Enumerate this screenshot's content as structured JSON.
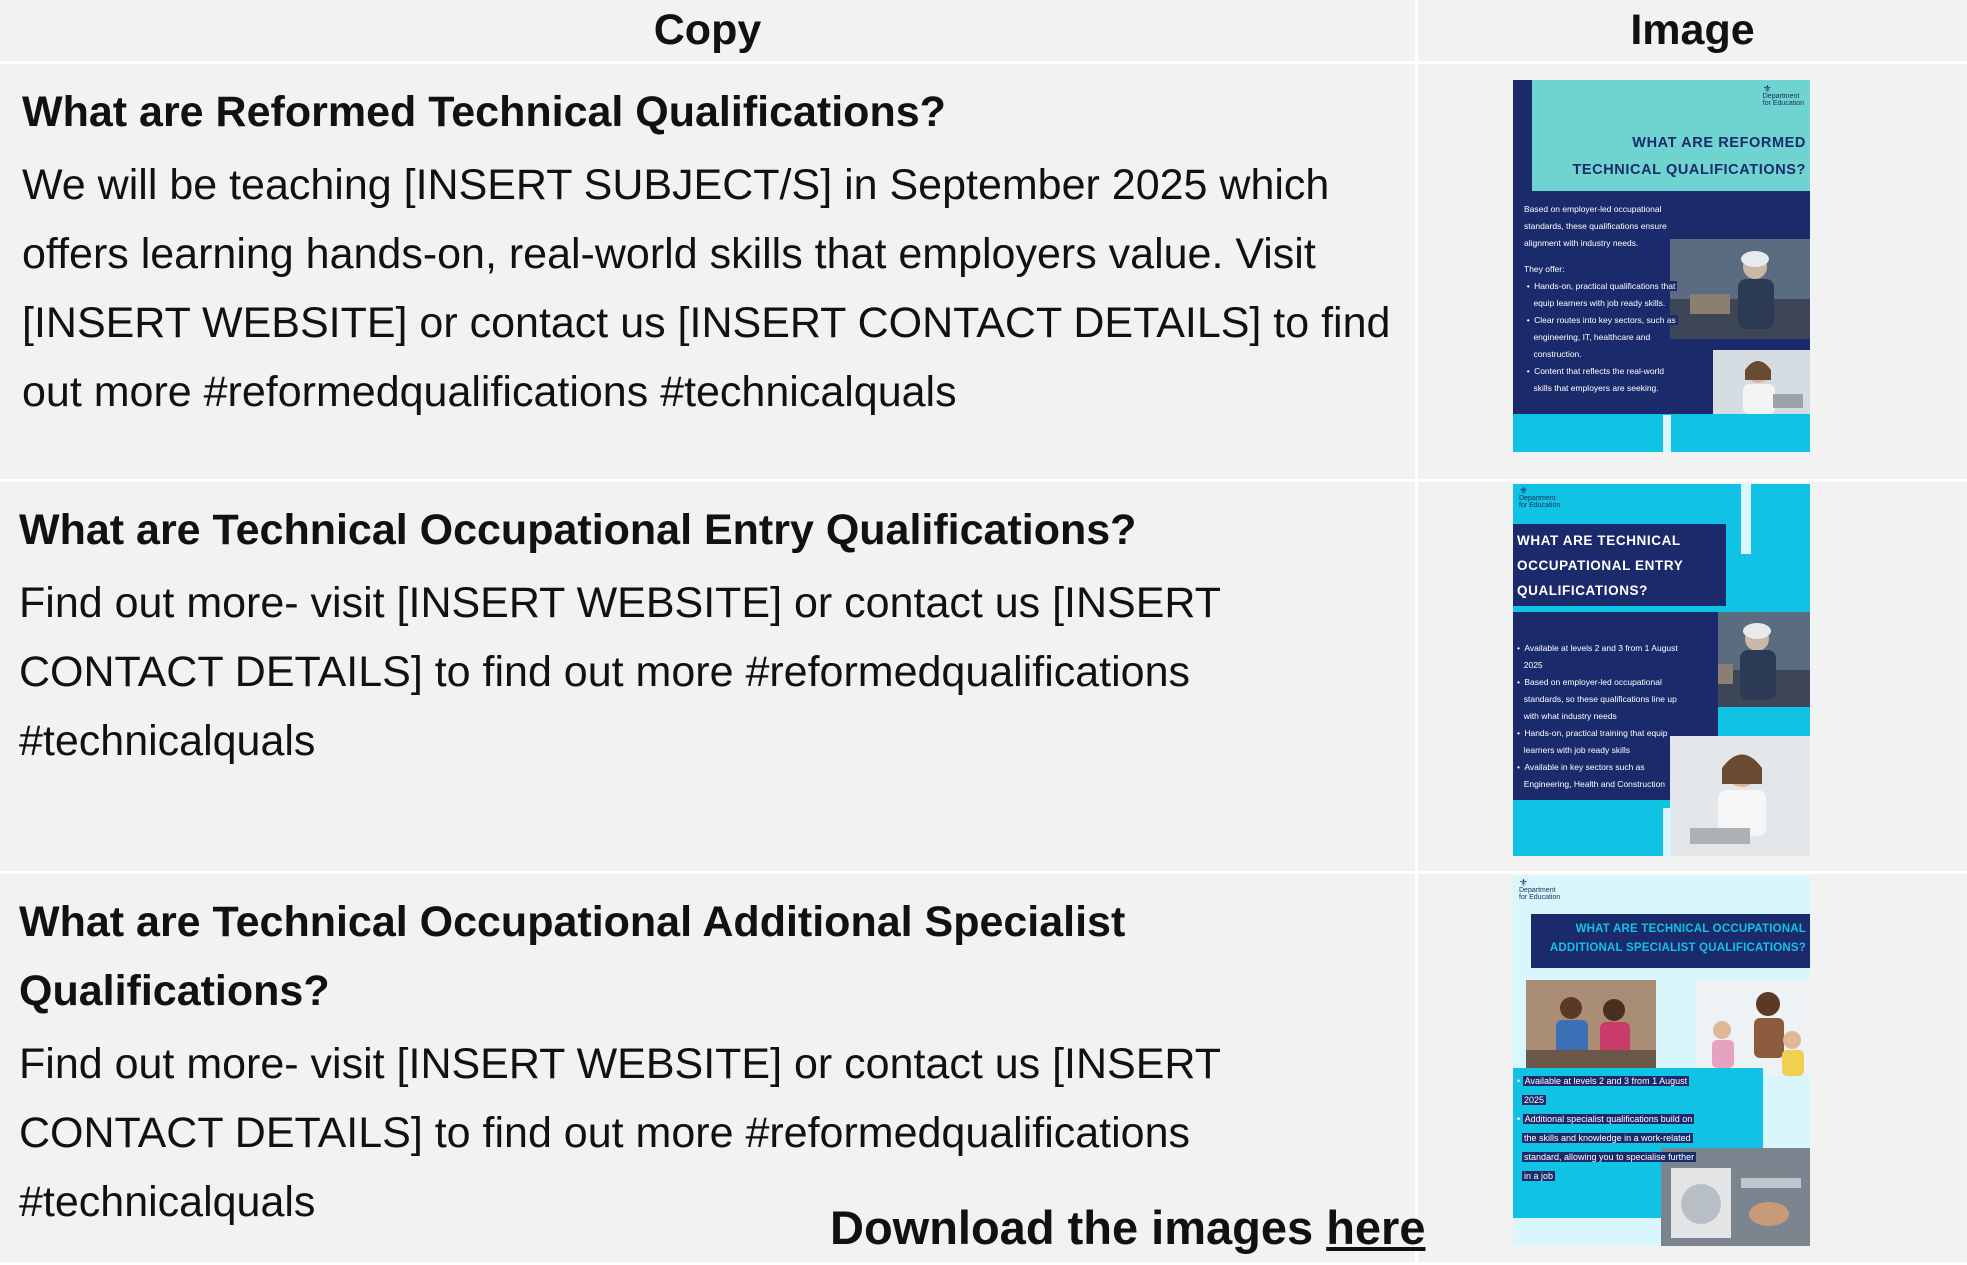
{
  "table": {
    "header": {
      "copy": "Copy",
      "image": "Image"
    },
    "rows": [
      {
        "title": "What are Reformed Technical Qualifications?",
        "body": "We will be teaching [INSERT SUBJECT/S] in September 2025 which offers learning hands-on, real-world skills that employers value. Visit [INSERT WEBSITE] or contact us [INSERT CONTACT DETAILS] to find out more #reformedqualifications #technicalquals",
        "poster": {
          "org_line1": "Department",
          "org_line2": "for Education",
          "title_line1": "WHAT ARE REFORMED",
          "title_line2": "TECHNICAL QUALIFICATIONS?",
          "intro": [
            "Based on employer-led occupational",
            "standards, these qualifications ensure",
            "alignment with industry needs."
          ],
          "offer_label": "They offer:",
          "bullets": [
            [
              "Hands-on, practical qualifications that",
              "equip learners with job ready skills."
            ],
            [
              "Clear routes into key sectors, such as",
              "engineering, IT, healthcare and",
              "construction."
            ],
            [
              "Content that reflects the real-world",
              "skills that employers are seeking."
            ]
          ]
        }
      },
      {
        "title": "What are Technical Occupational Entry Qualifications?",
        "body": "Find out more- visit [INSERT WEBSITE] or contact us [INSERT CONTACT DETAILS] to find out more #reformedqualifications #technicalquals",
        "poster": {
          "org_line1": "Department",
          "org_line2": "for Education",
          "title_lines": [
            "WHAT ARE TECHNICAL",
            "OCCUPATIONAL ENTRY",
            "QUALIFICATIONS?"
          ],
          "bullets": [
            [
              "Available at levels 2 and 3 from 1 August",
              "2025"
            ],
            [
              "Based on employer-led occupational",
              "standards, so these qualifications line up",
              "with what industry needs"
            ],
            [
              "Hands-on, practical training that equip",
              "learners with job ready skills"
            ],
            [
              "Available in key sectors such as",
              "Engineering, Health and Construction"
            ]
          ]
        }
      },
      {
        "title": "What are Technical Occupational Additional Specialist Qualifications?",
        "body": "Find out more- visit [INSERT WEBSITE] or contact us [INSERT CONTACT DETAILS] to find out more #reformedqualifications #technicalquals",
        "poster": {
          "org_line1": "Department",
          "org_line2": "for Education",
          "title_line1": "WHAT ARE TECHNICAL OCCUPATIONAL",
          "title_line2": "ADDITIONAL SPECIALIST QUALIFICATIONS?",
          "bullets": [
            [
              "Available at levels 2 and 3 from 1 August",
              "2025"
            ],
            [
              "Additional specialist qualifications build on",
              "the skills and knowledge in a work-related",
              "standard, allowing you to specialise further",
              "in a job"
            ]
          ]
        }
      }
    ]
  },
  "footer": {
    "text": "Download the images ",
    "link": "here"
  },
  "colors": {
    "navy": "#1b2a5c",
    "cyan": "#10c3e5",
    "teal": "#6fd3d0",
    "light": "#d8f6fb"
  }
}
